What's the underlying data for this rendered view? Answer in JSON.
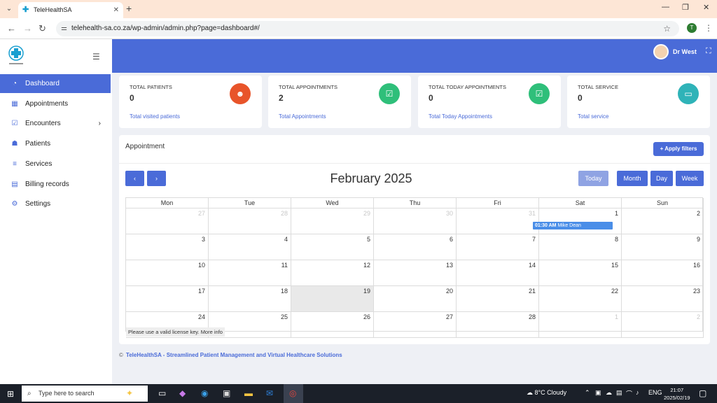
{
  "browser": {
    "tab_title": "TeleHealthSA",
    "url": "telehealth-sa.co.za/wp-admin/admin.php?page=dashboard#/",
    "profile_initial": "T"
  },
  "sidebar": {
    "items": [
      {
        "label": "Dashboard",
        "icon": "gauge-icon",
        "active": true
      },
      {
        "label": "Appointments",
        "icon": "calendar-icon",
        "active": false
      },
      {
        "label": "Encounters",
        "icon": "calendar-check-icon",
        "active": false,
        "has_submenu": true
      },
      {
        "label": "Patients",
        "icon": "users-icon",
        "active": false
      },
      {
        "label": "Services",
        "icon": "server-icon",
        "active": false
      },
      {
        "label": "Billing records",
        "icon": "file-icon",
        "active": false
      },
      {
        "label": "Settings",
        "icon": "gears-icon",
        "active": false
      }
    ]
  },
  "header": {
    "user_name": "Dr West"
  },
  "cards": [
    {
      "title": "TOTAL PATIENTS",
      "value": "0",
      "subtitle": "Total visited patients",
      "icon": "patient-icon",
      "color": "#e8542a"
    },
    {
      "title": "TOTAL APPOINTMENTS",
      "value": "2",
      "subtitle": "Total Appointments",
      "icon": "calendar-check-icon",
      "color": "#2fbf7a"
    },
    {
      "title": "TOTAL TODAY APPOINTMENTS",
      "value": "0",
      "subtitle": "Total Today Appointments",
      "icon": "calendar-check-icon",
      "color": "#2fbf7a"
    },
    {
      "title": "TOTAL SERVICE",
      "value": "0",
      "subtitle": "Total service",
      "icon": "id-card-icon",
      "color": "#2fb3b8"
    }
  ],
  "appointment": {
    "title": "Appointment",
    "filter_label": "Apply filters",
    "month_title": "February 2025",
    "today_label": "Today",
    "view_buttons": [
      "Month",
      "Day",
      "Week"
    ],
    "weekdays": [
      "Mon",
      "Tue",
      "Wed",
      "Thu",
      "Fri",
      "Sat",
      "Sun"
    ],
    "weeks": [
      [
        "27",
        "28",
        "29",
        "30",
        "31",
        "1",
        "2"
      ],
      [
        "3",
        "4",
        "5",
        "6",
        "7",
        "8",
        "9"
      ],
      [
        "10",
        "11",
        "12",
        "13",
        "14",
        "15",
        "16"
      ],
      [
        "17",
        "18",
        "19",
        "20",
        "21",
        "22",
        "23"
      ],
      [
        "24",
        "25",
        "26",
        "27",
        "28",
        "1",
        "2"
      ]
    ],
    "event": {
      "time": "01:30 AM",
      "name": "Mike Dean"
    },
    "license_text": "Please use a valid license key.",
    "license_link": "More info"
  },
  "footer": {
    "copyright": "©",
    "text": "TeleHealthSA - Streamlined Patient Management and Virtual Healthcare Solutions"
  },
  "taskbar": {
    "search_placeholder": "Type here to search",
    "weather": "8°C  Cloudy",
    "lang": "ENG",
    "time": "21:07",
    "date": "2025/02/19"
  },
  "colors": {
    "primary": "#4a6bd8",
    "event": "#4a8ee8"
  }
}
